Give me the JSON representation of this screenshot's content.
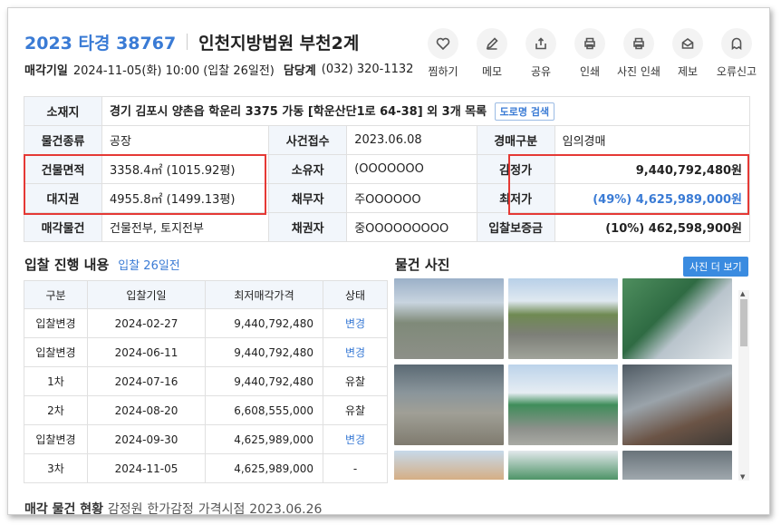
{
  "header": {
    "case_number": "2023 타경 38767",
    "court": "인천지방법원 부천2계",
    "sale_date_label": "매각기일",
    "sale_date_value": "2024-11-05(화) 10:00 (입찰 26일전)",
    "contact_label": "담당계",
    "contact_value": "(032) 320-1132"
  },
  "actions": [
    {
      "label": "찜하기",
      "icon": "heart-icon"
    },
    {
      "label": "메모",
      "icon": "pencil-icon"
    },
    {
      "label": "공유",
      "icon": "share-icon"
    },
    {
      "label": "인쇄",
      "icon": "printer-icon"
    },
    {
      "label": "사진 인쇄",
      "icon": "printer-icon"
    },
    {
      "label": "제보",
      "icon": "envelope-icon"
    },
    {
      "label": "오류신고",
      "icon": "ghost-icon"
    }
  ],
  "info": {
    "location_label": "소재지",
    "location_value": "경기 김포시 양촌읍 학운리 3375 가동 [학운산단1로 64-38] 외 3개 목록",
    "road_search": "도로명 검색",
    "rows": [
      {
        "l1": "물건종류",
        "v1": "공장",
        "l2": "사건접수",
        "v2": "2023.06.08",
        "l3": "경매구분",
        "v3": "임의경매"
      },
      {
        "l1": "건물면적",
        "v1": "3358.4㎡ (1015.92평)",
        "l2": "소유자",
        "v2": "(OOOOOOO",
        "l3": "감정가",
        "v3": "9,440,792,480원"
      },
      {
        "l1": "대지권",
        "v1": "4955.8㎡ (1499.13평)",
        "l2": "채무자",
        "v2": "주OOOOOO",
        "l3": "최저가",
        "v3": "(49%) 4,625,989,000원"
      },
      {
        "l1": "매각물건",
        "v1": "건물전부, 토지전부",
        "l2": "채권자",
        "v2": "중OOOOOOOOO",
        "l3": "입찰보증금",
        "v3": "(10%) 462,598,900원"
      }
    ]
  },
  "bids": {
    "title": "입찰 진행 내용",
    "subtitle": "입찰 26일전",
    "columns": [
      "구분",
      "입찰기일",
      "최저매각가격",
      "상태"
    ],
    "rows": [
      [
        "입찰변경",
        "2024-02-27",
        "9,440,792,480",
        "변경"
      ],
      [
        "입찰변경",
        "2024-06-11",
        "9,440,792,480",
        "변경"
      ],
      [
        "1차",
        "2024-07-16",
        "9,440,792,480",
        "유찰"
      ],
      [
        "2차",
        "2024-08-20",
        "6,608,555,000",
        "유찰"
      ],
      [
        "입찰변경",
        "2024-09-30",
        "4,625,989,000",
        "변경"
      ],
      [
        "3차",
        "2024-11-05",
        "4,625,989,000",
        "-"
      ]
    ]
  },
  "photos": {
    "title": "물건 사진",
    "more_button": "사진 더 보기"
  },
  "cutoff": {
    "text_a": "매각 물건 현황",
    "text_b": "감정원",
    "text_c": "한가감정",
    "text_d": "가격시점",
    "text_e": "2023.06.26"
  },
  "colors": {
    "accent": "#3a7bd5",
    "highlight_box": "#e53935",
    "header_cell": "#f2f6fb"
  }
}
